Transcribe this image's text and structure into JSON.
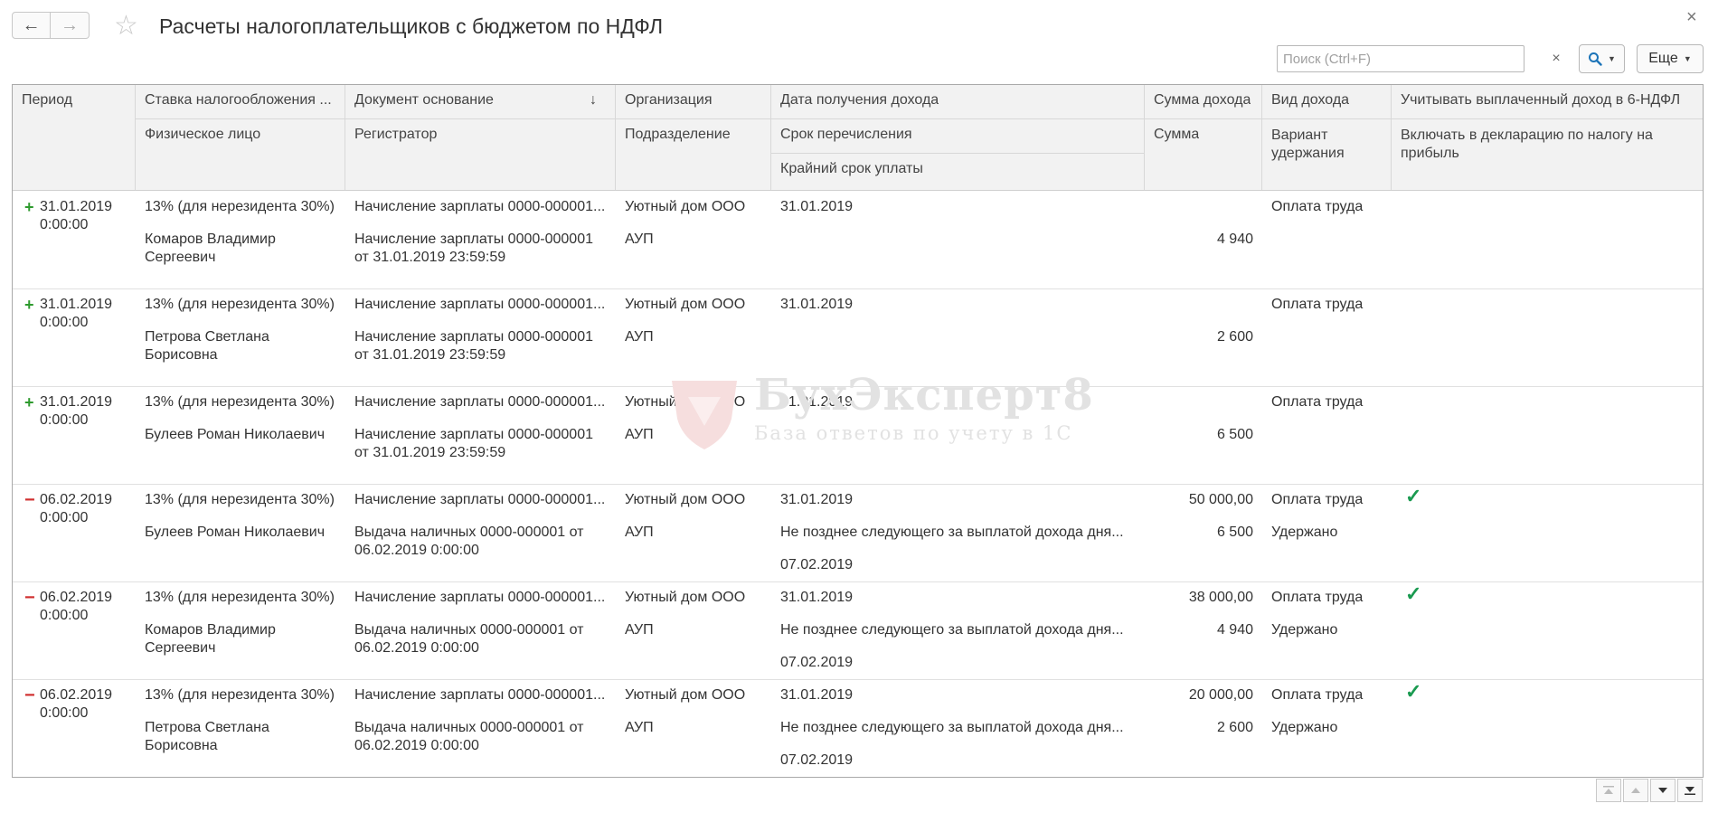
{
  "window": {
    "title": "Расчеты налогоплательщиков с бюджетом по НДФЛ",
    "search_placeholder": "Поиск (Ctrl+F)",
    "search_clear": "×",
    "more_label": "Еще",
    "back_icon": "←",
    "forward_icon": "→",
    "favorite_icon": "☆",
    "close_icon": "×"
  },
  "columns": {
    "period": "Период",
    "rate": "Ставка налогообложения ...",
    "person": "Физическое лицо",
    "doc_base": "Документ основание",
    "doc_sort_icon": "↓",
    "registrar": "Регистратор",
    "organization": "Организация",
    "department": "Подразделение",
    "income_date": "Дата получения дохода",
    "transfer_term": "Срок перечисления",
    "deadline": "Крайний срок уплаты",
    "income_sum": "Сумма дохода",
    "sum": "Сумма",
    "income_type": "Вид дохода",
    "withholding": "Вариант удержания",
    "count_paid": "Учитывать выплаченный доход в 6-НДФЛ",
    "include_decl": "Включать в декларацию по налогу на прибыль"
  },
  "rows": [
    {
      "sign": "+",
      "period": "31.01.2019",
      "time": "0:00:00",
      "rate": "13% (для нерезидента 30%)",
      "person1": "Комаров Владимир",
      "person2": "Сергеевич",
      "doc": "Начисление зарплаты 0000-000001...",
      "reg1": "Начисление зарплаты 0000-000001",
      "reg2": "от 31.01.2019 23:59:59",
      "org": "Уютный дом ООО",
      "dept": "АУП",
      "income_date": "31.01.2019",
      "term": "",
      "deadline": "",
      "income_sum": "",
      "sum": "4 940",
      "type": "Оплата труда",
      "withholding": "",
      "check": ""
    },
    {
      "sign": "+",
      "period": "31.01.2019",
      "time": "0:00:00",
      "rate": "13% (для нерезидента 30%)",
      "person1": "Петрова Светлана",
      "person2": "Борисовна",
      "doc": "Начисление зарплаты 0000-000001...",
      "reg1": "Начисление зарплаты 0000-000001",
      "reg2": "от 31.01.2019 23:59:59",
      "org": "Уютный дом ООО",
      "dept": "АУП",
      "income_date": "31.01.2019",
      "term": "",
      "deadline": "",
      "income_sum": "",
      "sum": "2 600",
      "type": "Оплата труда",
      "withholding": "",
      "check": ""
    },
    {
      "sign": "+",
      "period": "31.01.2019",
      "time": "0:00:00",
      "rate": "13% (для нерезидента 30%)",
      "person1": "Булеев Роман Николаевич",
      "person2": "",
      "doc": "Начисление зарплаты 0000-000001...",
      "reg1": "Начисление зарплаты 0000-000001",
      "reg2": "от 31.01.2019 23:59:59",
      "org": "Уютный дом ООО",
      "dept": "АУП",
      "income_date": "31.01.2019",
      "term": "",
      "deadline": "",
      "income_sum": "",
      "sum": "6 500",
      "type": "Оплата труда",
      "withholding": "",
      "check": ""
    },
    {
      "sign": "−",
      "period": "06.02.2019",
      "time": "0:00:00",
      "rate": "13% (для нерезидента 30%)",
      "person1": "Булеев Роман Николаевич",
      "person2": "",
      "doc": "Начисление зарплаты 0000-000001...",
      "reg1": "Выдача наличных 0000-000001 от",
      "reg2": "06.02.2019 0:00:00",
      "org": "Уютный дом ООО",
      "dept": "АУП",
      "income_date": "31.01.2019",
      "term": "Не позднее следующего за выплатой дохода дня...",
      "deadline": "07.02.2019",
      "income_sum": "50 000,00",
      "sum": "6 500",
      "type": "Оплата труда",
      "withholding": "Удержано",
      "check": "✓"
    },
    {
      "sign": "−",
      "period": "06.02.2019",
      "time": "0:00:00",
      "rate": "13% (для нерезидента 30%)",
      "person1": "Комаров Владимир",
      "person2": "Сергеевич",
      "doc": "Начисление зарплаты 0000-000001...",
      "reg1": "Выдача наличных 0000-000001 от",
      "reg2": "06.02.2019 0:00:00",
      "org": "Уютный дом ООО",
      "dept": "АУП",
      "income_date": "31.01.2019",
      "term": "Не позднее следующего за выплатой дохода дня...",
      "deadline": "07.02.2019",
      "income_sum": "38 000,00",
      "sum": "4 940",
      "type": "Оплата труда",
      "withholding": "Удержано",
      "check": "✓"
    },
    {
      "sign": "−",
      "period": "06.02.2019",
      "time": "0:00:00",
      "rate": "13% (для нерезидента 30%)",
      "person1": "Петрова Светлана",
      "person2": "Борисовна",
      "doc": "Начисление зарплаты 0000-000001...",
      "reg1": "Выдача наличных 0000-000001 от",
      "reg2": "06.02.2019 0:00:00",
      "org": "Уютный дом ООО",
      "dept": "АУП",
      "income_date": "31.01.2019",
      "term": "Не позднее следующего за выплатой дохода дня...",
      "deadline": "07.02.2019",
      "income_sum": "20 000,00",
      "sum": "2 600",
      "type": "Оплата труда",
      "withholding": "Удержано",
      "check": "✓"
    }
  ],
  "watermark": {
    "title": "БухЭксперт8",
    "subtitle": "База ответов по учету в 1С",
    "color": "#e2e2e2"
  },
  "colors": {
    "plus": "#2e9a2e",
    "minus": "#d03030",
    "check": "#1a9a50",
    "search_icon": "#1c74b8"
  }
}
